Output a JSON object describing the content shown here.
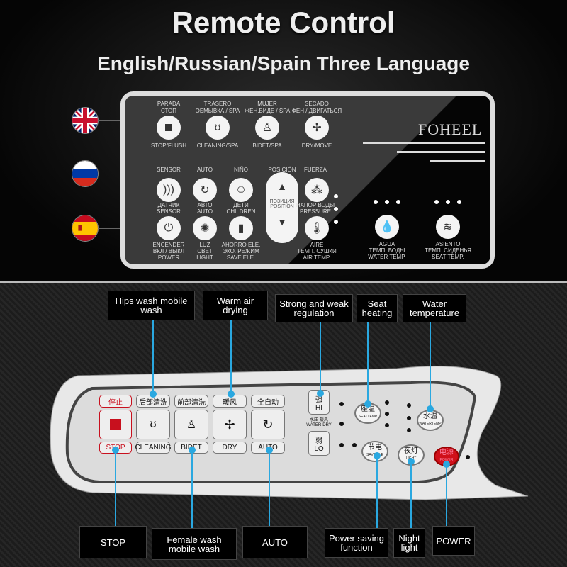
{
  "header": {
    "title": "Remote Control",
    "subtitle": "English/Russian/Spain Three Language"
  },
  "flags": [
    {
      "icon": "uk-flag-icon"
    },
    {
      "icon": "russia-flag-icon"
    },
    {
      "icon": "spain-flag-icon"
    }
  ],
  "remote": {
    "brand": "FOHEEL",
    "row1": [
      {
        "top1": "PARADA",
        "top2": "СТОП",
        "bottom": "STOP/FLUSH",
        "icon": "stop-icon"
      },
      {
        "top1": "TRASERO",
        "top2": "ОБМЫВКА / SPA",
        "bottom": "CLEANING/SPA",
        "icon": "hip-wash-icon"
      },
      {
        "top1": "MUJER",
        "top2": "ЖЕН.БИДЕ / SPA",
        "bottom": "BIDET/SPA",
        "icon": "bidet-icon"
      },
      {
        "top1": "SECADO",
        "top2": "ФЕН / ДВИГАТЬСЯ",
        "bottom": "DRY/MOVE",
        "icon": "fan-icon"
      }
    ],
    "row2": [
      {
        "top": "SENSOR",
        "b1": "ДАТЧИК",
        "b2": "SENSOR",
        "icon": "sensor-icon"
      },
      {
        "top": "AUTO",
        "b1": "АВТО",
        "b2": "AUTO",
        "icon": "auto-cycle-icon"
      },
      {
        "top": "NIÑO",
        "b1": "ДЕТИ",
        "b2": "CHILDREN",
        "icon": "child-face-icon"
      }
    ],
    "row3": [
      {
        "b1": "ENCENDER",
        "b2": "ВКЛ / ВЫКЛ",
        "b3": "POWER",
        "icon": "power-icon"
      },
      {
        "b1": "LUZ",
        "b2": "СВЕТ",
        "b3": "LIGHT",
        "icon": "light-bulb-icon"
      },
      {
        "b1": "AHORRO ELE.",
        "b2": "ЭКО. РЕЖИМ",
        "b3": "SAVE ELE.",
        "icon": "battery-icon"
      }
    ],
    "position": {
      "top": "POSICIÓN",
      "l1": "ПОЗИЦИЯ",
      "l2": "POSITION",
      "up": "▲",
      "down": "▼"
    },
    "pressure": {
      "top": "FUERZA",
      "b1": "НАПОР ВОДЫ",
      "b2": "PRESSURE",
      "icon": "spray-icon"
    },
    "air": {
      "b1": "AIRE",
      "b2": "ТЕМП. СУШКИ",
      "b3": "AIR TEMP.",
      "icon": "thermometer-icon"
    },
    "water": {
      "b1": "AGUA",
      "b2": "ТЕМП. ВОДЫ",
      "b3": "WATER TEMP.",
      "icon": "water-temp-icon"
    },
    "seat": {
      "b1": "ASIENTO",
      "b2": "ТЕМП. СИДЕНЬЯ",
      "b3": "SEAT TEMP.",
      "icon": "seat-temp-icon"
    }
  },
  "callouts": {
    "hips": "Hips wash mobile wash",
    "warm": "Warm air drying",
    "strong": "Strong and weak regulation",
    "seat": "Seat heating",
    "water": "Water temperature",
    "stop": "STOP",
    "female": "Female wash mobile wash",
    "auto": "AUTO",
    "saving": "Power saving function",
    "night": "Night light",
    "power": "POWER"
  },
  "panel": {
    "stop_cn": "停止",
    "stop_en": "STOP",
    "keys": [
      {
        "cn": "后部清洗",
        "en": "CLEANING",
        "icon": "hip-wash-icon"
      },
      {
        "cn": "前部清洗",
        "en": "BIDET",
        "icon": "bidet-icon"
      },
      {
        "cn": "暖风",
        "en": "DRY",
        "icon": "fan-icon"
      },
      {
        "cn": "全自动",
        "en": "AUTO",
        "icon": "auto-cycle-icon"
      }
    ],
    "hi_cn": "强",
    "hi": "HI",
    "mid_cn": "水压·暖风",
    "mid": "WATER·DRY",
    "lo_cn": "弱",
    "lo": "LO",
    "seat_cn": "座温",
    "seat": "SEATTEMP",
    "water_cn": "水温",
    "water": "WATERTEMP",
    "save_cn": "节电",
    "save": "SAVE ELE",
    "light_cn": "夜灯",
    "light": "LIGHT",
    "power_cn": "电源",
    "power": "POWER"
  },
  "colors": {
    "accent": "#2aa8e0",
    "stop_red": "#c8101e"
  }
}
